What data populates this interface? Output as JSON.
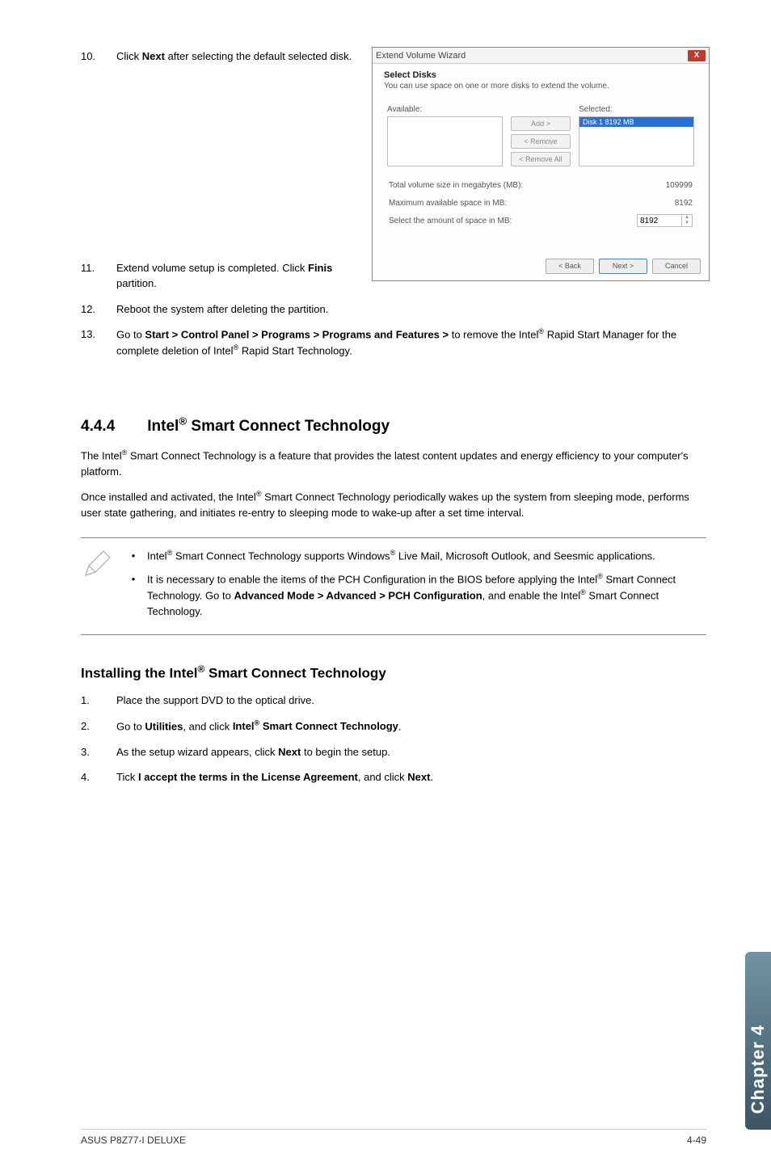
{
  "steps_top": [
    {
      "num": "10.",
      "text_before": "Click ",
      "bold1": "Next",
      "text_after": " after selecting the default selected disk."
    }
  ],
  "dialog": {
    "title": "Extend Volume Wizard",
    "close": "X",
    "header": "Select Disks",
    "sub": "You can use space on one or more disks to extend the volume.",
    "avail_label": "Available:",
    "sel_label": "Selected:",
    "sel_item": "Disk 1    8192 MB",
    "btn_add": "Add >",
    "btn_remove": "< Remove",
    "btn_remove_all": "< Remove All",
    "f1_label": "Total volume size in megabytes (MB):",
    "f1_val": "109999",
    "f2_label": "Maximum available space in MB:",
    "f2_val": "8192",
    "f3_label": "Select the amount of space in MB:",
    "f3_val": "8192",
    "back": "< Back",
    "next": "Next >",
    "cancel": "Cancel"
  },
  "step11": {
    "num": "11.",
    "t1": "Extend volume setup is completed. Click ",
    "bold": "Finis",
    "t2": "partition."
  },
  "step12": {
    "num": "12.",
    "text": "Reboot the system after deleting the partition."
  },
  "step13": {
    "num": "13.",
    "t1": "Go to ",
    "bold1": "Start > Control Panel > Programs > Programs and Features > ",
    "t2": "to remove the Intel",
    "t3": " Rapid Start Manager for the complete deletion of Intel",
    "t4": " Rapid Start Technology."
  },
  "section": {
    "num": "4.4.4",
    "title_a": "Intel",
    "title_b": " Smart Connect Technology"
  },
  "para1": {
    "a": "The Intel",
    "b": " Smart Connect Technology is a feature that provides the latest content updates and  energy efficiency to your computer's platform."
  },
  "para2": {
    "a": "Once installed and activated, the Intel",
    "b": " Smart Connect Technology periodically wakes up the system from sleeping mode, performs user state gathering, and initiates re-entry to sleeping mode to wake-up after a set time interval."
  },
  "note1": {
    "a": "Intel",
    "b": " Smart Connect Technology supports Windows",
    "c": " Live Mail, Microsoft Outlook, and Seesmic applications."
  },
  "note2": {
    "a": "It is necessary to enable the items of the PCH Configuration in the BIOS before applying the Intel",
    "b": " Smart Connect Technology. Go to ",
    "bold1": "Advanced Mode > Advanced > PCH Configuration",
    "c": ", and enable the Intel",
    "d": " Smart Connect Technology."
  },
  "subhead": {
    "a": "Installing the Intel",
    "b": " Smart Connect Technology"
  },
  "inst1": {
    "num": "1.",
    "text": "Place the support DVD to the optical drive."
  },
  "inst2": {
    "num": "2.",
    "a": "Go to ",
    "b1": "Utilities",
    "b": ", and click ",
    "b2a": "Intel",
    "b2b": " Smart Connect Technology",
    "c": "."
  },
  "inst3": {
    "num": "3.",
    "a": "As the setup wizard appears, click ",
    "b": "Next",
    "c": " to begin the setup."
  },
  "inst4": {
    "num": "4.",
    "a": "Tick ",
    "b": "I accept the terms in the License Agreement",
    "c": ", and click ",
    "d": "Next",
    "e": "."
  },
  "sidetab": "Chapter 4",
  "footer_left": "ASUS P8Z77-I DELUXE",
  "footer_right": "4-49",
  "reg": "®"
}
